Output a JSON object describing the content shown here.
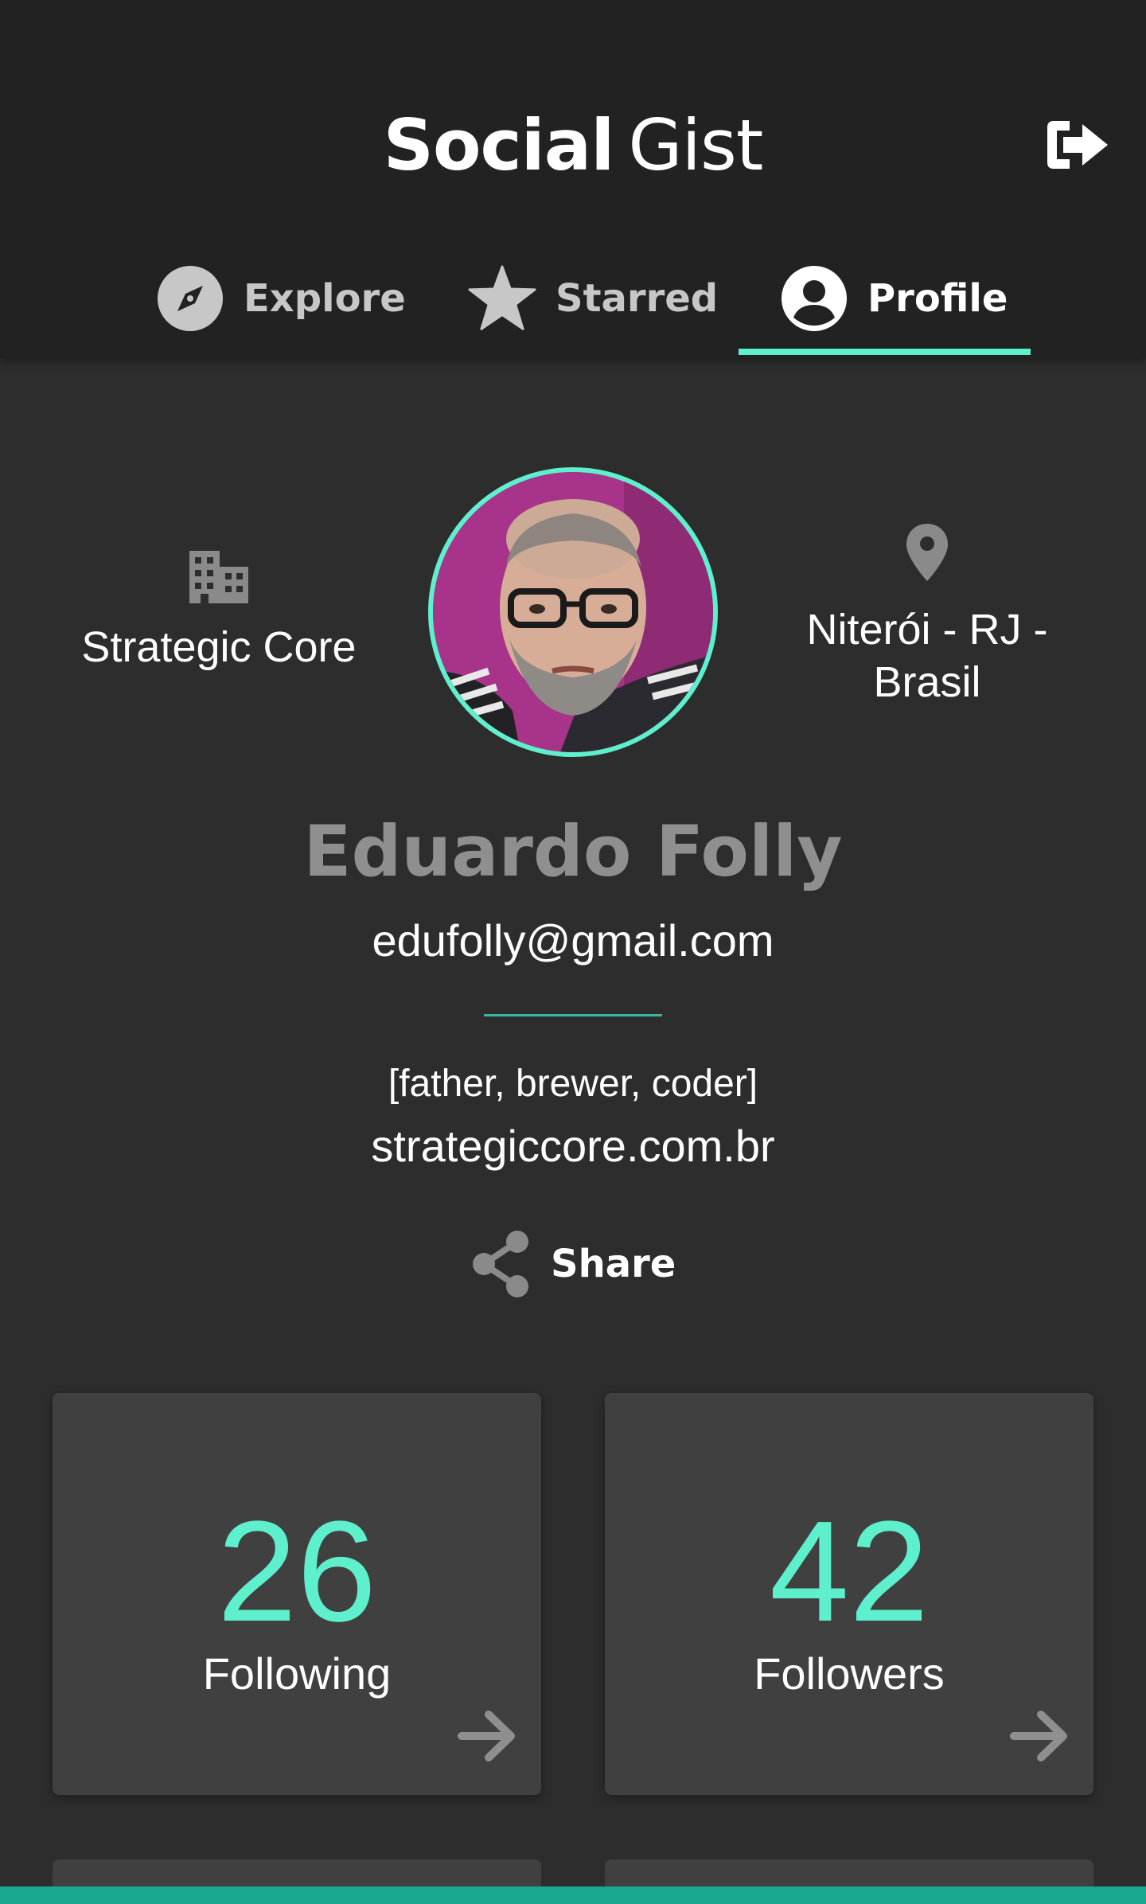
{
  "header": {
    "brand_bold": "Social",
    "brand_light": "Gist",
    "logout_icon": "sign-out-icon"
  },
  "tabs": [
    {
      "label": "Explore",
      "icon": "compass-icon",
      "active": false
    },
    {
      "label": "Starred",
      "icon": "star-icon",
      "active": false
    },
    {
      "label": "Profile",
      "icon": "account-circle-icon",
      "active": true
    }
  ],
  "profile": {
    "company": "Strategic Core",
    "company_icon": "building-icon",
    "location": "Niterói - RJ - Brasil",
    "location_icon": "map-pin-icon",
    "name": "Eduardo Folly",
    "email": "edufolly@gmail.com",
    "bio": "[father, brewer, coder]",
    "website": "strategiccore.com.br",
    "share_label": "Share",
    "share_icon": "share-icon"
  },
  "stats": [
    {
      "value": "26",
      "label": "Following",
      "icon": "arrow-right-icon"
    },
    {
      "value": "42",
      "label": "Followers",
      "icon": "arrow-right-icon"
    }
  ],
  "colors": {
    "accent": "#5ef0cc",
    "header_bg": "#222222",
    "page_bg": "#2d2d2d",
    "card_bg": "#404040",
    "name_gray": "#8f8f8f",
    "bottom_bar": "#1aa893"
  }
}
